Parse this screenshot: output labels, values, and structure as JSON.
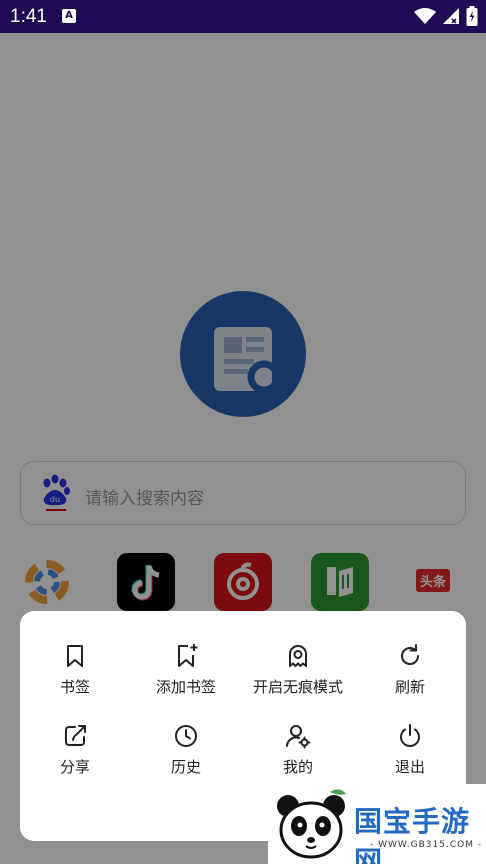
{
  "status_bar": {
    "time": "1:41",
    "notification_letter": "A"
  },
  "search": {
    "placeholder": "请输入搜索内容",
    "engine_logo_text": "du"
  },
  "quick_links": [
    {
      "name": "photos",
      "text": ""
    },
    {
      "name": "tiktok",
      "text": ""
    },
    {
      "name": "netease-music",
      "text": ""
    },
    {
      "name": "reader",
      "text": ""
    },
    {
      "name": "toutiao",
      "text": "头条"
    }
  ],
  "menu": {
    "items": [
      {
        "label": "书签",
        "icon": "bookmark-icon"
      },
      {
        "label": "添加书签",
        "icon": "add-bookmark-icon"
      },
      {
        "label": "开启无痕模式",
        "icon": "incognito-icon"
      },
      {
        "label": "刷新",
        "icon": "refresh-icon"
      },
      {
        "label": "分享",
        "icon": "share-icon"
      },
      {
        "label": "历史",
        "icon": "history-icon"
      },
      {
        "label": "我的",
        "icon": "user-settings-icon"
      },
      {
        "label": "退出",
        "icon": "power-icon"
      }
    ]
  },
  "watermark": {
    "brand": "国宝手游网",
    "url": "- WWW.GB315.COM -"
  },
  "colors": {
    "status_bar": "#1d0a52",
    "brand_blue": "#2a62b4",
    "scrim": "rgba(0,0,0,0.43)"
  }
}
